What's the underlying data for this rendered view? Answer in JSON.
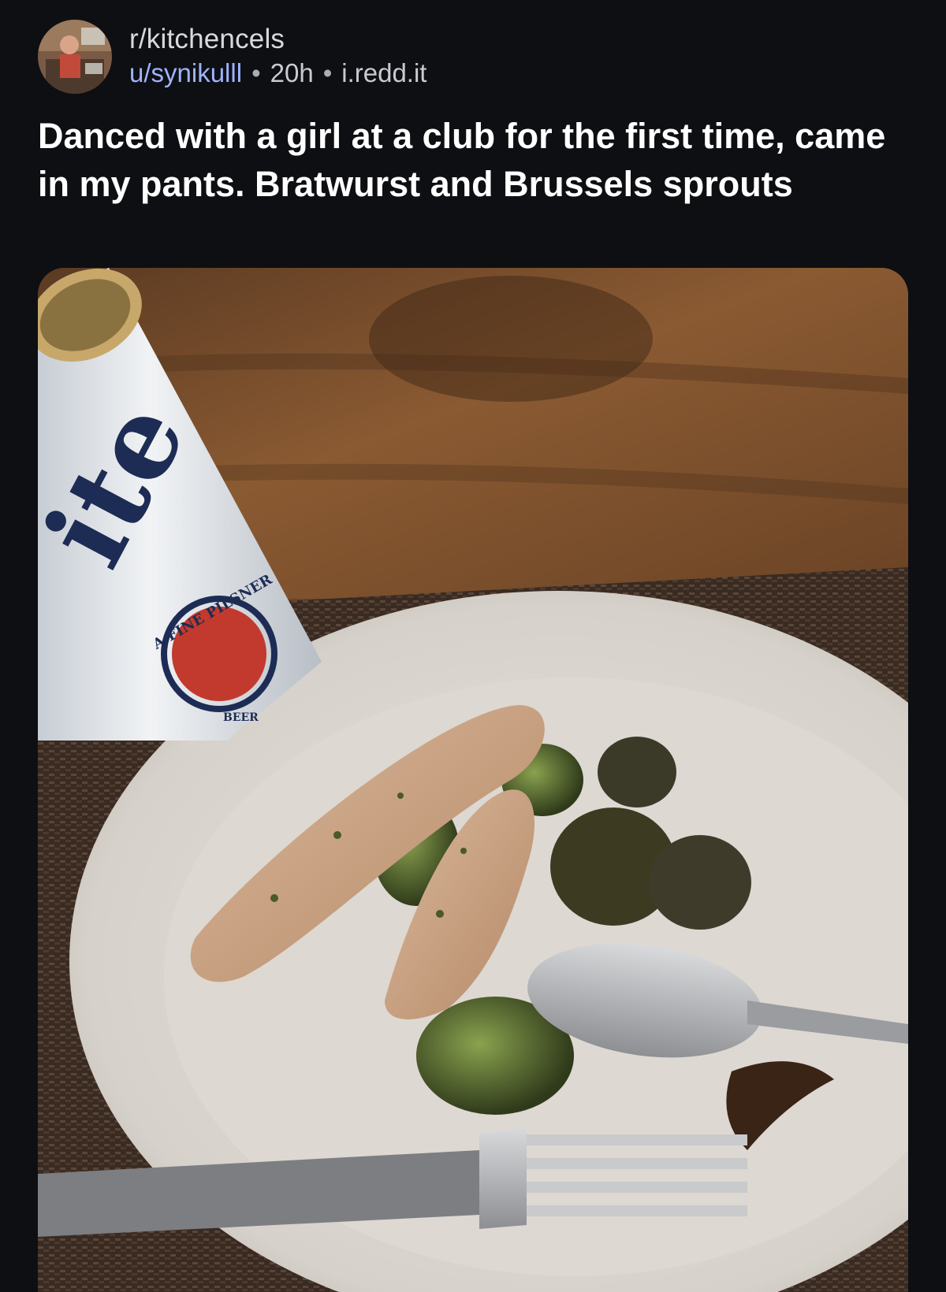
{
  "post": {
    "subreddit": "r/kitchencels",
    "username": "u/synikulll",
    "separator": "•",
    "time_ago": "20h",
    "domain": "i.redd.it",
    "title": "Danced with a girl at a club for the first time, came in my pants. Bratwurst and Brussels sprouts"
  },
  "image": {
    "can_brand_text": "ite",
    "can_ring_text": "A FINE PILSNER",
    "can_bottom_text": "BEER"
  },
  "colors": {
    "background": "#0e0f12",
    "username": "#9fb3ff",
    "text": "#ffffff",
    "meta": "#c8cbd2"
  },
  "icons": {
    "avatar": "subreddit-avatar-icon"
  }
}
